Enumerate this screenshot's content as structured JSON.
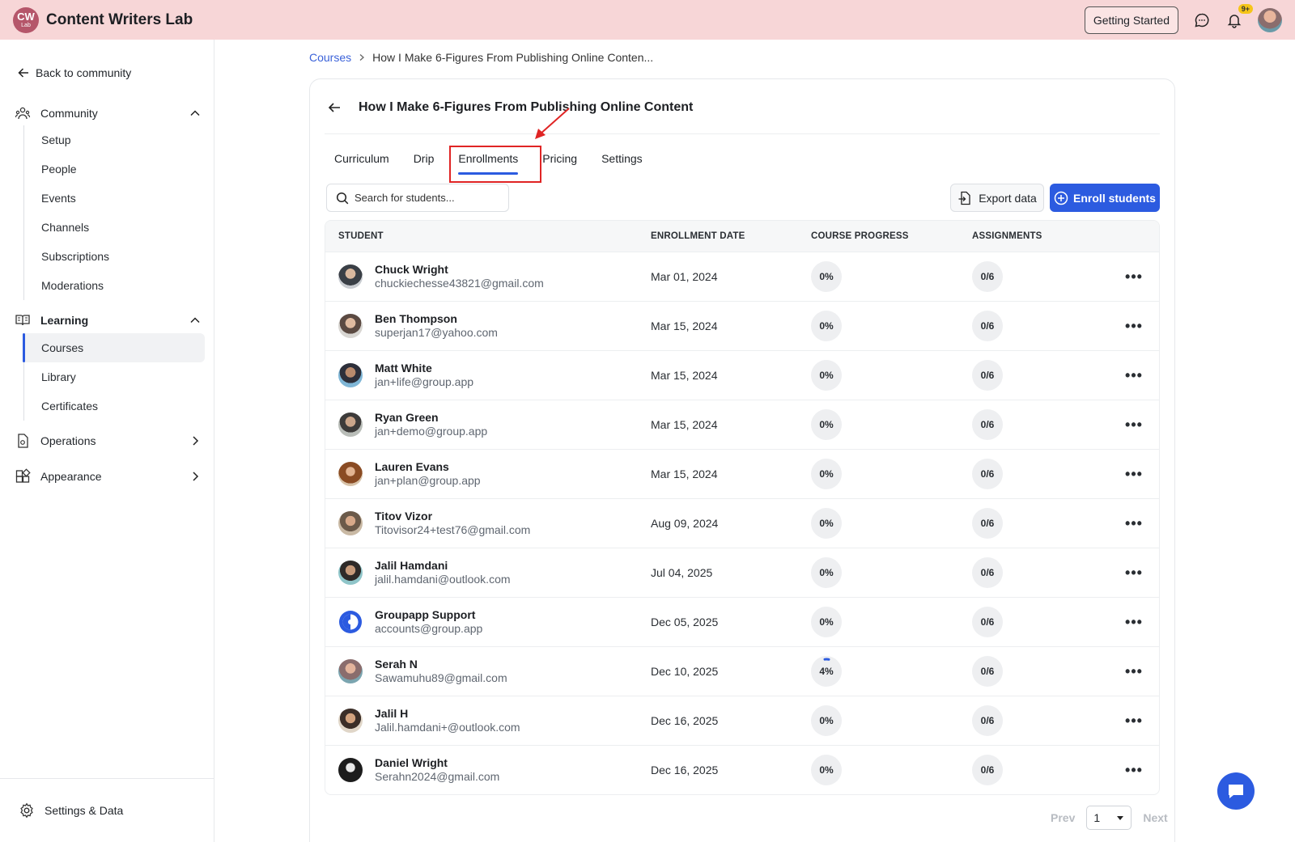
{
  "app": {
    "logo_line1": "CW",
    "logo_line2": "Lab",
    "title": "Content Writers Lab"
  },
  "topbar": {
    "getting_started": "Getting Started",
    "notification_count": "9+"
  },
  "sidebar": {
    "back_label": "Back to community",
    "community": {
      "label": "Community",
      "items": [
        "Setup",
        "People",
        "Events",
        "Channels",
        "Subscriptions",
        "Moderations"
      ]
    },
    "learning": {
      "label": "Learning",
      "items": [
        "Courses",
        "Library",
        "Certificates"
      ],
      "active": "Courses"
    },
    "operations_label": "Operations",
    "appearance_label": "Appearance",
    "footer_label": "Settings & Data"
  },
  "breadcrumb": {
    "root": "Courses",
    "current": "How I Make 6-Figures From Publishing Online Conten..."
  },
  "course": {
    "title": "How I Make 6-Figures From Publishing Online Content"
  },
  "tabs": [
    {
      "label": "Curriculum"
    },
    {
      "label": "Drip"
    },
    {
      "label": "Enrollments",
      "active": true
    },
    {
      "label": "Pricing"
    },
    {
      "label": "Settings"
    }
  ],
  "search": {
    "placeholder": "Search for students..."
  },
  "actions": {
    "export": "Export data",
    "enroll": "Enroll students"
  },
  "table": {
    "columns": {
      "student": "STUDENT",
      "date": "ENROLLMENT DATE",
      "progress": "COURSE PROGRESS",
      "assignments": "ASSIGNMENTS"
    },
    "rows": [
      {
        "name": "Chuck Wright",
        "email": "chuckiechesse43821@gmail.com",
        "date": "Mar 01, 2024",
        "progress": "0%",
        "assignments": "0/6"
      },
      {
        "name": "Ben Thompson",
        "email": "superjan17@yahoo.com",
        "date": "Mar 15, 2024",
        "progress": "0%",
        "assignments": "0/6"
      },
      {
        "name": "Matt White",
        "email": "jan+life@group.app",
        "date": "Mar 15, 2024",
        "progress": "0%",
        "assignments": "0/6"
      },
      {
        "name": "Ryan Green",
        "email": "jan+demo@group.app",
        "date": "Mar 15, 2024",
        "progress": "0%",
        "assignments": "0/6"
      },
      {
        "name": "Lauren Evans",
        "email": "jan+plan@group.app",
        "date": "Mar 15, 2024",
        "progress": "0%",
        "assignments": "0/6"
      },
      {
        "name": "Titov Vizor",
        "email": "Titovisor24+test76@gmail.com",
        "date": "Aug 09, 2024",
        "progress": "0%",
        "assignments": "0/6"
      },
      {
        "name": "Jalil Hamdani",
        "email": "jalil.hamdani@outlook.com",
        "date": "Jul 04, 2025",
        "progress": "0%",
        "assignments": "0/6"
      },
      {
        "name": "Groupapp Support",
        "email": "accounts@group.app",
        "date": "Dec 05, 2025",
        "progress": "0%",
        "assignments": "0/6"
      },
      {
        "name": "Serah N",
        "email": "Sawamuhu89@gmail.com",
        "date": "Dec 10, 2025",
        "progress": "4%",
        "assignments": "0/6"
      },
      {
        "name": "Jalil H",
        "email": "Jalil.hamdani+@outlook.com",
        "date": "Dec 16, 2025",
        "progress": "0%",
        "assignments": "0/6"
      },
      {
        "name": "Daniel Wright",
        "email": "Serahn2024@gmail.com",
        "date": "Dec 16, 2025",
        "progress": "0%",
        "assignments": "0/6"
      }
    ]
  },
  "pager": {
    "prev": "Prev",
    "page": "1",
    "next": "Next"
  },
  "colors": {
    "accent": "#2c5be0",
    "topbar": "#f7d6d7",
    "annotation": "#e02424"
  }
}
